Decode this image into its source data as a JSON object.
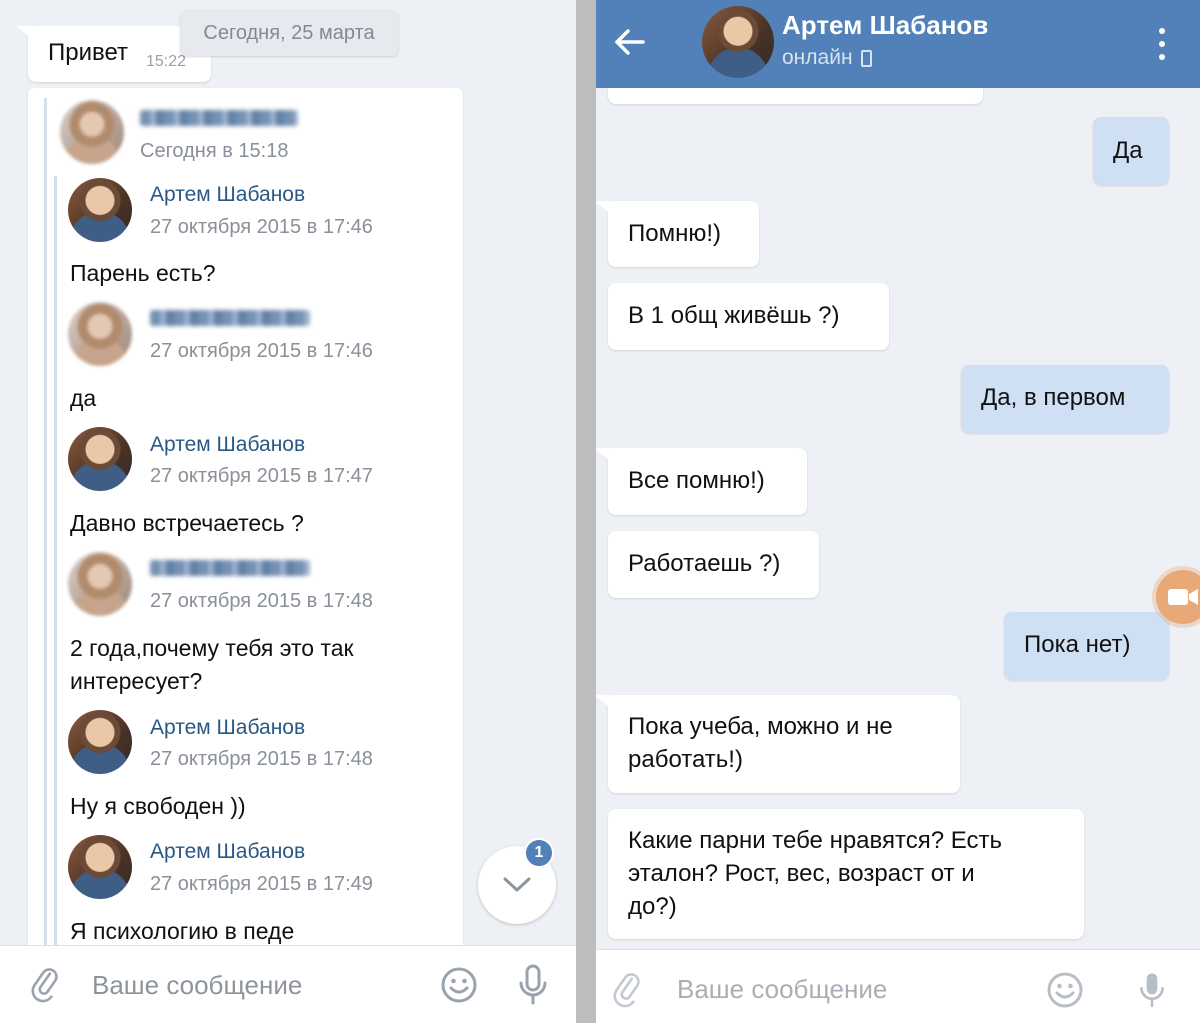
{
  "left": {
    "date_chip": "Сегодня, 25 марта",
    "first_message": {
      "text": "Привет",
      "time": "15:22"
    },
    "forward": {
      "outer_stamp": "Сегодня в 15:18",
      "messages": [
        {
          "author": "Артем Шабанов",
          "stamp": "27 октября 2015 в 17:46",
          "text": "Парень есть?"
        },
        {
          "author": "",
          "stamp": "27 октября 2015 в 17:46",
          "text": "да"
        },
        {
          "author": "Артем Шабанов",
          "stamp": "27 октября 2015 в 17:47",
          "text": "Давно встречаетесь ?"
        },
        {
          "author": "",
          "stamp": "27 октября 2015 в 17:48",
          "text_line1": "2 года,почему тебя это так",
          "text_line2": "интересует?"
        },
        {
          "author": "Артем Шабанов",
          "stamp": "27 октября 2015 в 17:48",
          "text": "Ну я свободен ))"
        },
        {
          "author": "Артем Шабанов",
          "stamp": "27 октября 2015 в 17:49",
          "text": "Я психологию в педе"
        }
      ]
    },
    "unread_badge": "1",
    "compose_placeholder": "Ваше сообщение"
  },
  "right": {
    "header": {
      "title": "Артем Шабанов",
      "status": "онлайн"
    },
    "messages": [
      {
        "dir": "out",
        "text": "Да"
      },
      {
        "dir": "in",
        "text": "Помню!)"
      },
      {
        "dir": "in",
        "text": "В 1 общ живёшь ?)"
      },
      {
        "dir": "out",
        "text": "Да, в первом"
      },
      {
        "dir": "in",
        "text": "Все помню!)"
      },
      {
        "dir": "in",
        "text": "Работаешь ?)"
      },
      {
        "dir": "out",
        "text": "Пока нет)"
      },
      {
        "dir": "in",
        "line1": "Пока учеба, можно и не",
        "line2": "работать!)"
      },
      {
        "dir": "in",
        "line1": "Какие парни тебе нравятся? Есть",
        "line2": "эталон? Рост, вес, возраст от и",
        "line3": "до?)"
      }
    ],
    "compose_placeholder": "Ваше сообщение"
  },
  "colors": {
    "header_blue": "#5181b8",
    "link_blue": "#2a5885",
    "out_bubble": "#cfe0f4",
    "background": "#edf0f4"
  }
}
